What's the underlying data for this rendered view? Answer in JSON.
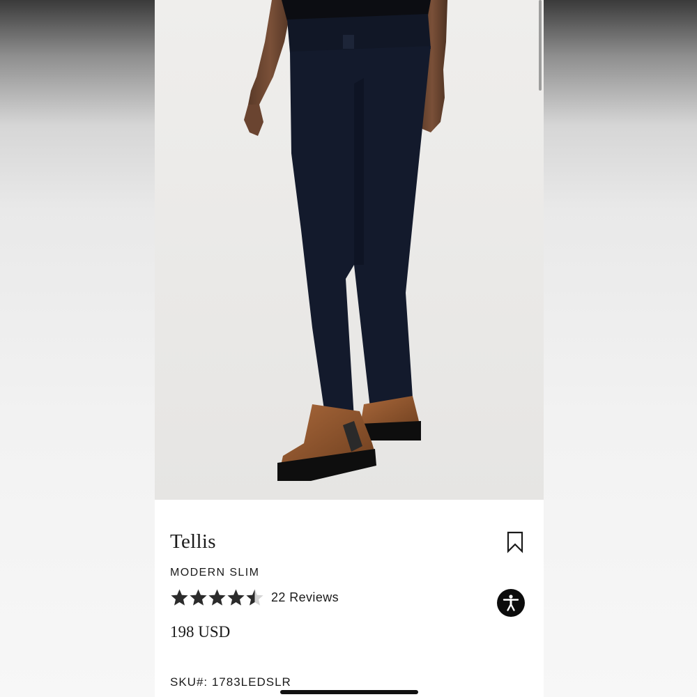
{
  "product": {
    "name": "Tellis",
    "fit": "MODERN SLIM",
    "rating": 4.5,
    "rating_max": 5,
    "reviews_label": "22 Reviews",
    "price": "198 USD",
    "sku": "SKU#: 1783LEDSLR"
  },
  "icons": {
    "bookmark": "bookmark-icon",
    "accessibility": "accessibility-icon",
    "star": "star-icon"
  },
  "colors": {
    "text": "#1a1a1a",
    "star_filled": "#2b2b2b",
    "star_empty": "#d4d4d4",
    "accessibility_bg": "#0c0c0c"
  }
}
